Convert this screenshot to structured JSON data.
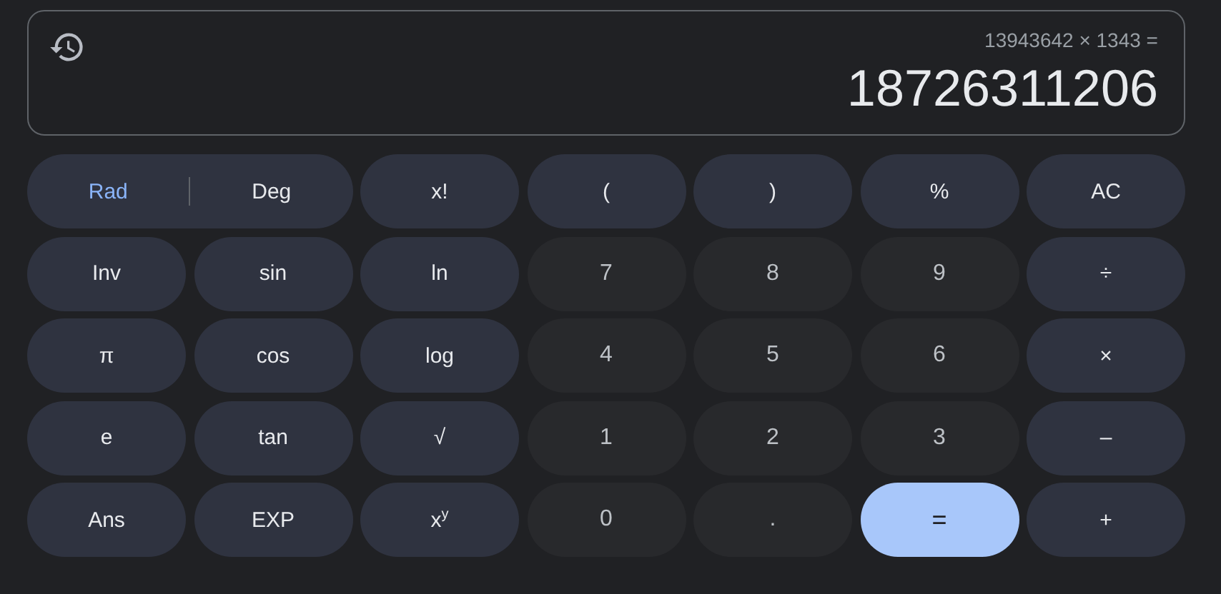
{
  "display": {
    "expression": "13943642 × 1343 =",
    "result": "18726311206"
  },
  "angle_toggle": [
    {
      "label": "Rad",
      "selected": true
    },
    {
      "label": "Deg",
      "selected": false
    }
  ],
  "keys": [
    {
      "label": "x!",
      "kind": "function"
    },
    {
      "label": "(",
      "kind": "function"
    },
    {
      "label": ")",
      "kind": "function"
    },
    {
      "label": "%",
      "kind": "function"
    },
    {
      "label": "AC",
      "kind": "function"
    },
    {
      "label": "Inv",
      "kind": "function"
    },
    {
      "label": "sin",
      "kind": "function"
    },
    {
      "label": "ln",
      "kind": "function"
    },
    {
      "label": "7",
      "kind": "digit"
    },
    {
      "label": "8",
      "kind": "digit"
    },
    {
      "label": "9",
      "kind": "digit"
    },
    {
      "label": "÷",
      "kind": "function"
    },
    {
      "label": "π",
      "kind": "function"
    },
    {
      "label": "cos",
      "kind": "function"
    },
    {
      "label": "log",
      "kind": "function"
    },
    {
      "label": "4",
      "kind": "digit"
    },
    {
      "label": "5",
      "kind": "digit"
    },
    {
      "label": "6",
      "kind": "digit"
    },
    {
      "label": "×",
      "kind": "function"
    },
    {
      "label": "e",
      "kind": "function"
    },
    {
      "label": "tan",
      "kind": "function"
    },
    {
      "label": "√",
      "kind": "function"
    },
    {
      "label": "1",
      "kind": "digit"
    },
    {
      "label": "2",
      "kind": "digit"
    },
    {
      "label": "3",
      "kind": "digit"
    },
    {
      "label": "–",
      "kind": "function"
    },
    {
      "label": "Ans",
      "kind": "function"
    },
    {
      "label": "EXP",
      "kind": "function"
    },
    {
      "label": "x$^{y}$",
      "kind": "function"
    },
    {
      "label": "0",
      "kind": "digit"
    },
    {
      "label": ".",
      "kind": "digit"
    },
    {
      "label": "=",
      "kind": "equals"
    },
    {
      "label": "+",
      "kind": "function"
    }
  ]
}
